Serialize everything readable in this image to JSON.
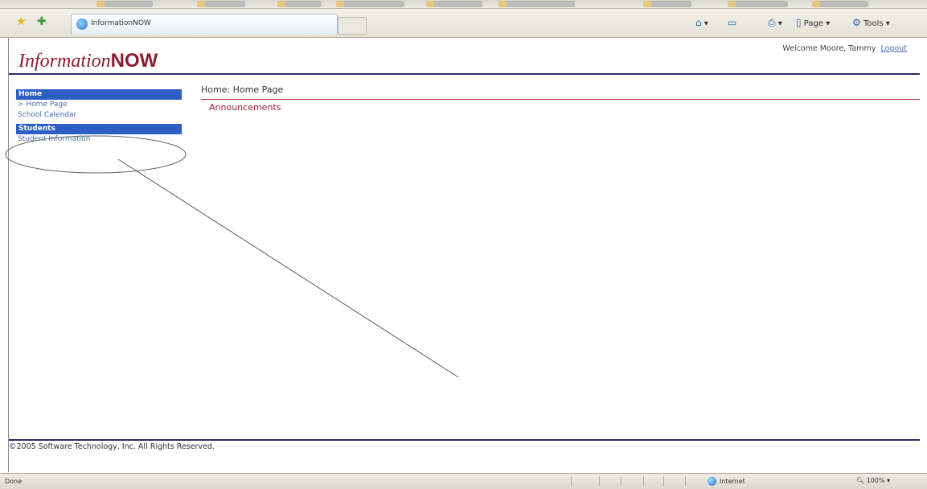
{
  "browser": {
    "tab_title": "InformationNOW",
    "toolbar": {
      "page_label": "Page",
      "tools_label": "Tools"
    },
    "status": {
      "left_text": "Done",
      "zone_label": "Internet",
      "zoom_label": "100%"
    }
  },
  "header": {
    "logo_part1": "Information",
    "logo_part2": "NOW",
    "welcome_text": "Welcome Moore, Tammy",
    "logout_label": "Logout"
  },
  "sidebar": {
    "sections": [
      {
        "title": "Home",
        "items": [
          "> Home Page",
          "School Calendar"
        ]
      },
      {
        "title": "Students",
        "items": [
          "Student Information"
        ]
      }
    ]
  },
  "main": {
    "breadcrumb": "Home: Home Page",
    "announcements": "Announcements"
  },
  "footer": {
    "copyright": "©2005 Software Technology, Inc. All Rights Reserved."
  },
  "colors": {
    "brand": "#8c1c2e",
    "nav_header": "#2d5ec4",
    "link": "#4a6fb3",
    "rule": "#2a2b66"
  }
}
